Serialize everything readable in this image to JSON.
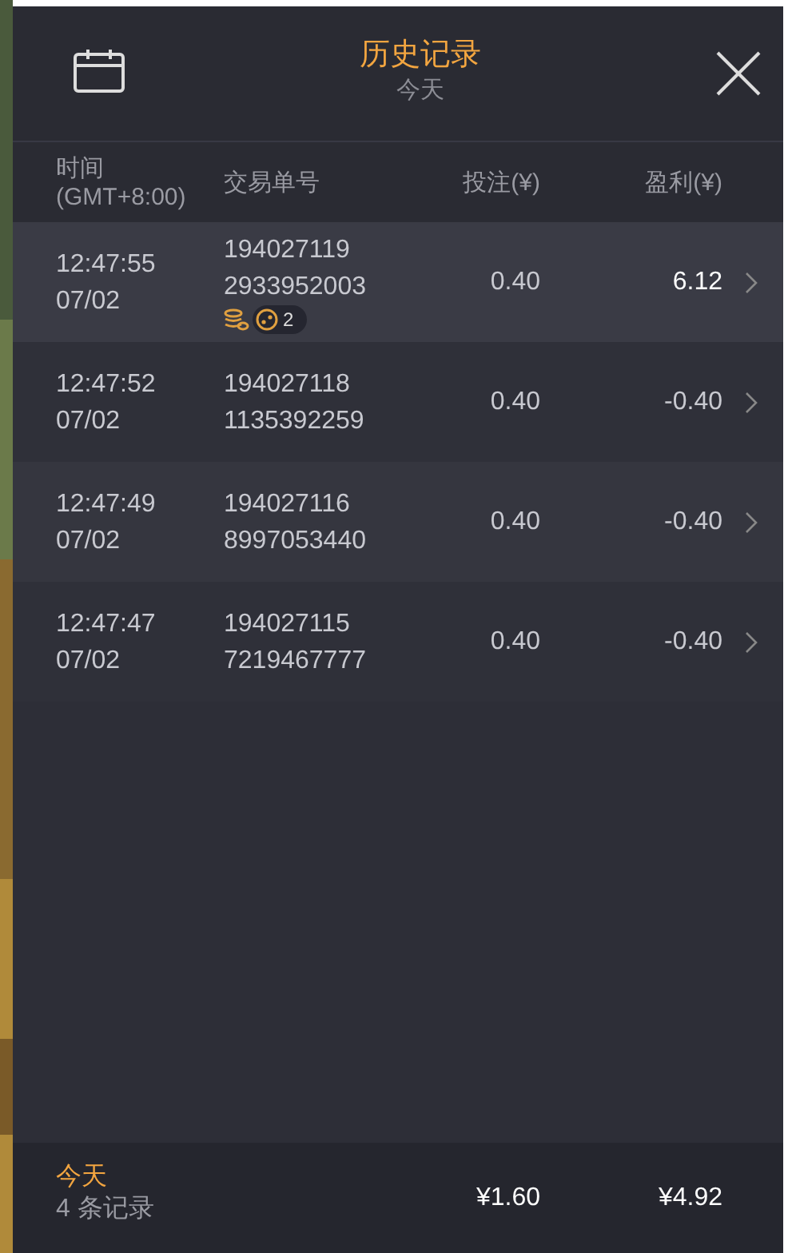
{
  "header": {
    "title": "历史记录",
    "subtitle": "今天"
  },
  "columns": [
    "时间",
    "(GMT+8:00)",
    "交易单号",
    "投注(¥)",
    "盈利(¥)"
  ],
  "rows": [
    {
      "time": "12:47:55",
      "date": "07/02",
      "id1": "194027119",
      "id2": "2933952003",
      "bet": "0.40",
      "profit": "6.12",
      "win": true,
      "free_spin_count": "2"
    },
    {
      "time": "12:47:52",
      "date": "07/02",
      "id1": "194027118",
      "id2": "1135392259",
      "bet": "0.40",
      "profit": "-0.40",
      "win": false
    },
    {
      "time": "12:47:49",
      "date": "07/02",
      "id1": "194027116",
      "id2": "8997053440",
      "bet": "0.40",
      "profit": "-0.40",
      "win": false
    },
    {
      "time": "12:47:47",
      "date": "07/02",
      "id1": "194027115",
      "id2": "7219467777",
      "bet": "0.40",
      "profit": "-0.40",
      "win": false
    }
  ],
  "footer": {
    "period": "今天",
    "count": "4 条记录",
    "total_bet": "¥1.60",
    "total_profit": "¥4.92"
  }
}
